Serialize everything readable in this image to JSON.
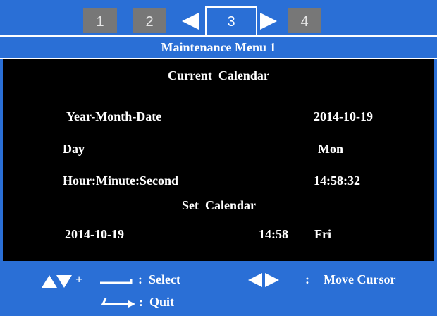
{
  "colors": {
    "accent": "#2a6fd6",
    "panel": "#000000",
    "tab_inactive": "#777777",
    "text": "#ffffff"
  },
  "tabs": [
    {
      "label": "1",
      "active": false
    },
    {
      "label": "2",
      "active": false
    },
    {
      "label": "3",
      "active": true
    },
    {
      "label": "4",
      "active": false
    }
  ],
  "icons": {
    "prev_tab": "left-triangle-icon",
    "next_tab": "right-triangle-icon"
  },
  "menu": {
    "title": "Maintenance  Menu  1"
  },
  "current_calendar": {
    "heading": "Current  Calendar",
    "rows": [
      {
        "label": "Year-Month-Date",
        "value": "2014-10-19"
      },
      {
        "label": "Day",
        "value": "Mon"
      },
      {
        "label": "Hour:Minute:Second",
        "value": "14:58:32"
      }
    ]
  },
  "set_calendar": {
    "heading": "Set  Calendar",
    "date": "2014-10-19",
    "time": "14:58",
    "day": "Fri"
  },
  "hints": {
    "plus": "+",
    "select": ":  Select",
    "quit": ":  Quit",
    "colon": ":",
    "move_cursor": "Move Cursor"
  }
}
